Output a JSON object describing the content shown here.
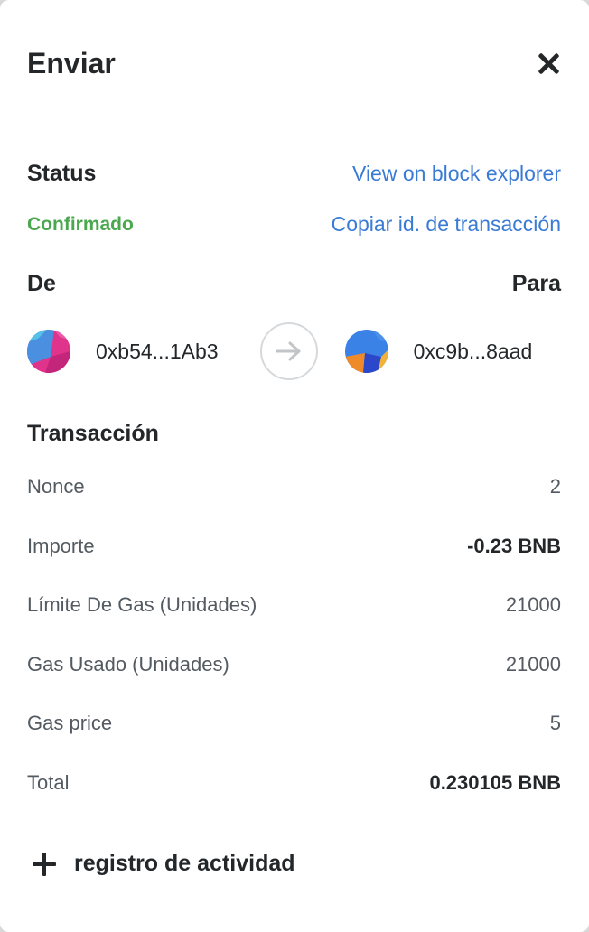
{
  "header": {
    "title": "Enviar",
    "close_icon": "close-icon"
  },
  "status": {
    "label": "Status",
    "value": "Confirmado",
    "value_color": "#4aa84e",
    "explorer_link": "View on block explorer",
    "copy_link": "Copiar id. de transacción"
  },
  "transfer": {
    "from_label": "De",
    "to_label": "Para",
    "from_address": "0xb54...1Ab3",
    "to_address": "0xc9b...8aad",
    "arrow_icon": "arrow-right-icon"
  },
  "transaction": {
    "title": "Transacción",
    "rows": [
      {
        "key": "Nonce",
        "value": "2"
      },
      {
        "key": "Importe",
        "value": "-0.23 BNB"
      },
      {
        "key": "Límite De Gas (Unidades)",
        "value": "21000"
      },
      {
        "key": "Gas Usado (Unidades)",
        "value": "21000"
      },
      {
        "key": "Gas price",
        "value": "5"
      },
      {
        "key": "Total",
        "value": "0.230105 BNB"
      }
    ]
  },
  "activity": {
    "label": "registro de actividad",
    "icon": "plus-icon"
  },
  "colors": {
    "link": "#3a7bd5",
    "text": "#24272a",
    "muted": "#535a61"
  }
}
